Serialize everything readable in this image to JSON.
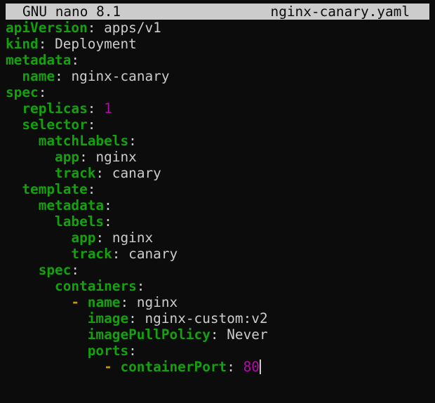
{
  "titlebar": {
    "app_name": "GNU nano 8.1",
    "file_name": "nginx-canary.yaml"
  },
  "colors": {
    "background": "#0c0c0c",
    "titlebar_bg": "#cccccc",
    "key": "#13a10e",
    "number": "#b40aa8",
    "dash": "#c19c00",
    "text": "#cccccc"
  },
  "editor": {
    "lines": [
      {
        "indent": 0,
        "key": "apiVersion",
        "value": "apps/v1",
        "type": "str"
      },
      {
        "indent": 0,
        "key": "kind",
        "value": "Deployment",
        "type": "str"
      },
      {
        "indent": 0,
        "key": "metadata",
        "value": "",
        "type": "none"
      },
      {
        "indent": 2,
        "key": "name",
        "value": "nginx-canary",
        "type": "str"
      },
      {
        "indent": 0,
        "key": "spec",
        "value": "",
        "type": "none"
      },
      {
        "indent": 2,
        "key": "replicas",
        "value": "1",
        "type": "num"
      },
      {
        "indent": 2,
        "key": "selector",
        "value": "",
        "type": "none"
      },
      {
        "indent": 4,
        "key": "matchLabels",
        "value": "",
        "type": "none"
      },
      {
        "indent": 6,
        "key": "app",
        "value": "nginx",
        "type": "str"
      },
      {
        "indent": 6,
        "key": "track",
        "value": "canary",
        "type": "str"
      },
      {
        "indent": 2,
        "key": "template",
        "value": "",
        "type": "none"
      },
      {
        "indent": 4,
        "key": "metadata",
        "value": "",
        "type": "none"
      },
      {
        "indent": 6,
        "key": "labels",
        "value": "",
        "type": "none"
      },
      {
        "indent": 8,
        "key": "app",
        "value": "nginx",
        "type": "str"
      },
      {
        "indent": 8,
        "key": "track",
        "value": "canary",
        "type": "str"
      },
      {
        "indent": 4,
        "key": "spec",
        "value": "",
        "type": "none"
      },
      {
        "indent": 6,
        "key": "containers",
        "value": "",
        "type": "none"
      },
      {
        "indent": 8,
        "dash": true,
        "key": "name",
        "value": "nginx",
        "type": "str"
      },
      {
        "indent": 10,
        "key": "image",
        "value": "nginx-custom:v2",
        "type": "str"
      },
      {
        "indent": 10,
        "key": "imagePullPolicy",
        "value": "Never",
        "type": "str"
      },
      {
        "indent": 10,
        "key": "ports",
        "value": "",
        "type": "none"
      },
      {
        "indent": 12,
        "dash": true,
        "key": "containerPort",
        "value": "80",
        "type": "num",
        "cursor": true
      }
    ]
  }
}
